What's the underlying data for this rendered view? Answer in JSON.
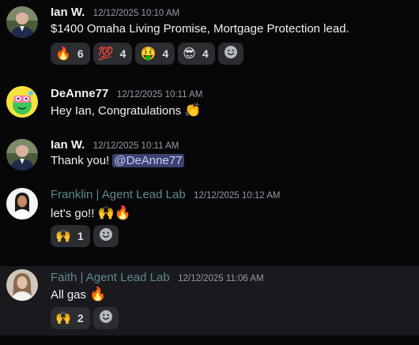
{
  "messages": [
    {
      "username": "Ian W.",
      "timestamp": "12/12/2025 10:10 AM",
      "text": "$1400 Omaha Living Promise,  Mortgage Protection lead.",
      "reactions": [
        {
          "emoji": "🔥",
          "count": "6"
        },
        {
          "emoji": "💯",
          "count": "4"
        },
        {
          "emoji": "🤑",
          "count": "4"
        },
        {
          "emoji": "😎",
          "count": "4"
        }
      ]
    },
    {
      "username": "DeAnne77",
      "timestamp": "12/12/2025 10:11 AM",
      "text": "Hey Ian, Congratulations",
      "emoji": "👏"
    },
    {
      "username": "Ian W.",
      "timestamp": "12/12/2025 10:11 AM",
      "text": "Thank you!",
      "mention": "@DeAnne77"
    },
    {
      "username": "Franklin | Agent Lead Lab",
      "timestamp": "12/12/2025 10:12 AM",
      "text": "let's go!!",
      "emoji": "🙌🔥",
      "reactions": [
        {
          "emoji": "🙌",
          "count": "1"
        }
      ]
    },
    {
      "username": "Faith | Agent Lead Lab",
      "timestamp": "12/12/2025 11:06 AM",
      "text": "All gas",
      "emoji": "🔥",
      "reactions": [
        {
          "emoji": "🙌",
          "count": "2"
        }
      ]
    }
  ],
  "icons": {
    "add_reaction": "smiley-plus-icon"
  },
  "colors": {
    "background": "#070709",
    "reaction_bg": "#2b2d31",
    "mention_bg": "#3c4270",
    "muted_username": "#5d8a8f",
    "highlight_bg": "#1a1a1e"
  }
}
